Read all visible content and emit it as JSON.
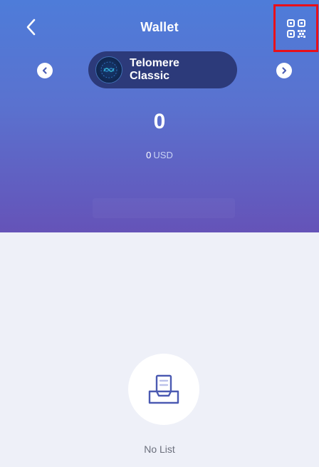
{
  "header": {
    "title": "Wallet",
    "back_icon": "chevron-left-icon",
    "qr_icon": "qr-code-icon"
  },
  "coin_selector": {
    "name": "Telomere Classic",
    "prev_icon": "chevron-left-circle-icon",
    "next_icon": "chevron-right-circle-icon",
    "logo_icon": "telomere-coin-logo"
  },
  "balance": {
    "amount": "0",
    "fiat_value": "0",
    "fiat_unit": "USD"
  },
  "list": {
    "empty_text": "No List",
    "empty_icon": "inbox-icon"
  },
  "colors": {
    "gradient_top": "#4e7cd9",
    "gradient_bottom": "#6553b8",
    "pill": "#2c3a7a",
    "highlight_border": "#e8101a",
    "background": "#eef0f8"
  }
}
